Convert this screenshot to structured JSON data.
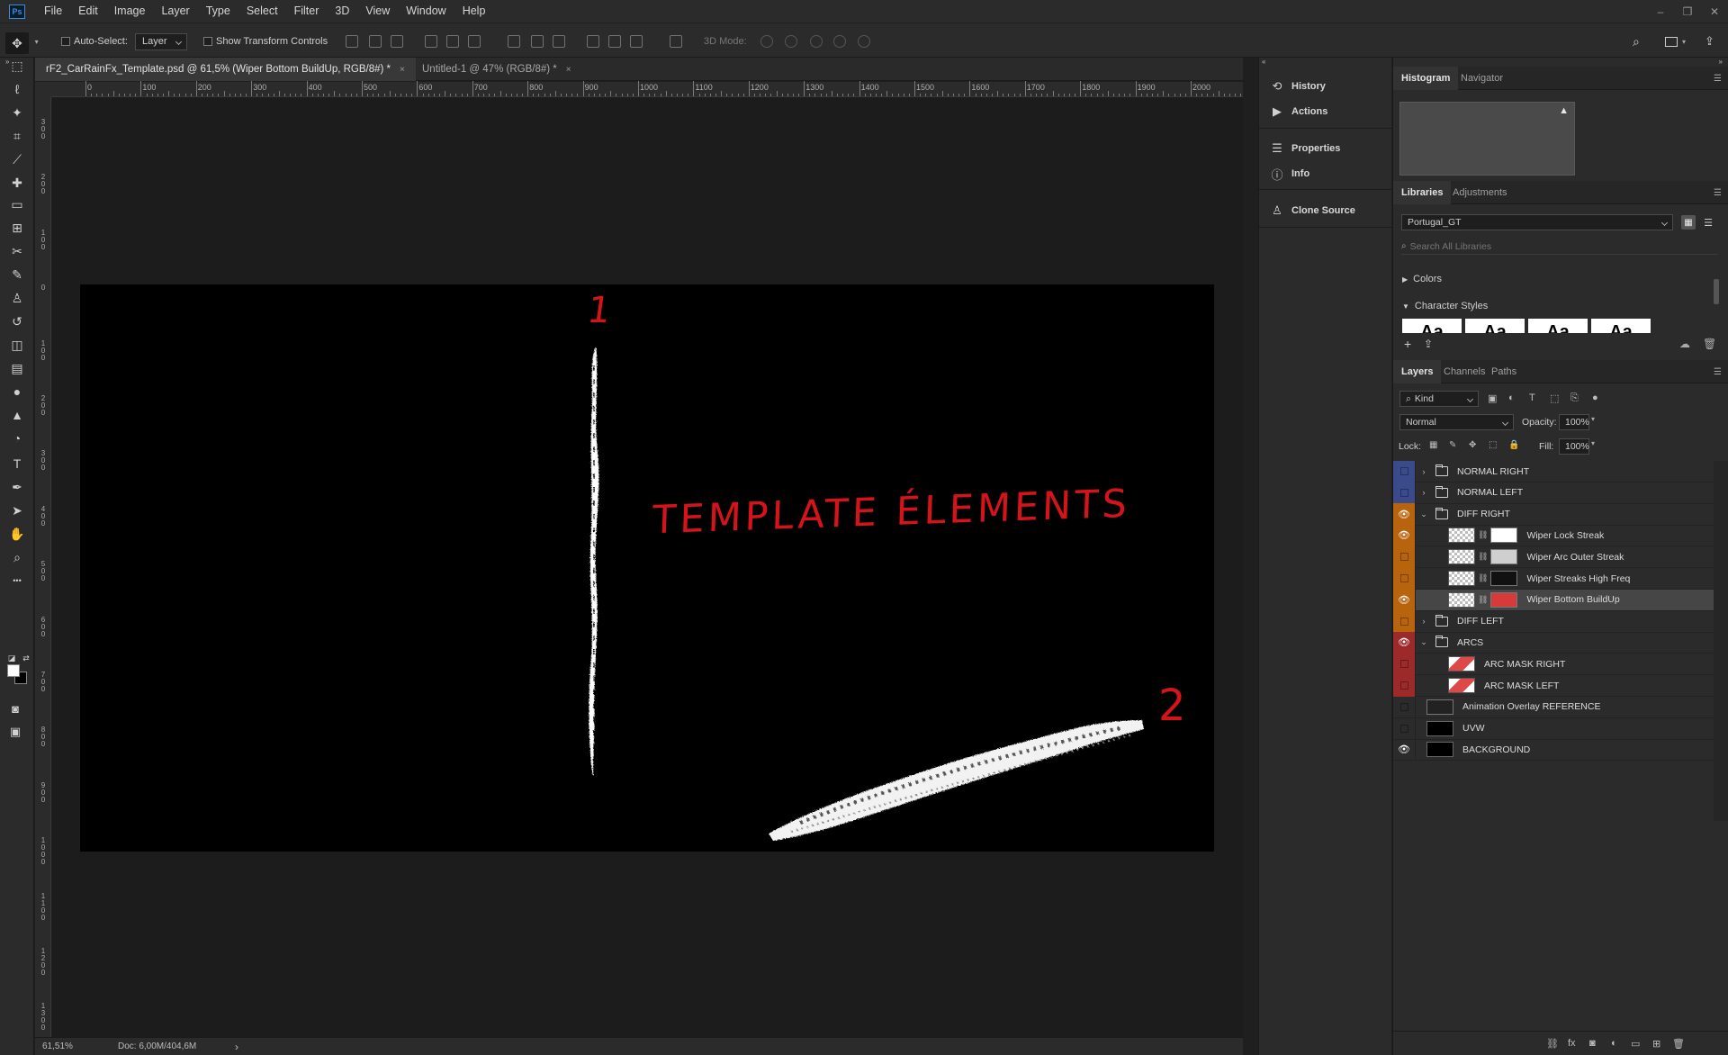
{
  "app": {
    "logo": "Ps"
  },
  "menu": [
    "File",
    "Edit",
    "Image",
    "Layer",
    "Type",
    "Select",
    "Filter",
    "3D",
    "View",
    "Window",
    "Help"
  ],
  "window_controls": [
    "–",
    "❐",
    "✕"
  ],
  "options": {
    "auto_select_label": "Auto-Select:",
    "auto_select_value": "Layer",
    "show_transform_label": "Show Transform Controls",
    "mode_3d_label": "3D Mode:"
  },
  "tabs": [
    {
      "label": "rF2_CarRainFx_Template.psd @ 61,5% (Wiper Bottom BuildUp, RGB/8#) *",
      "close": "×"
    },
    {
      "label": "Untitled-1 @ 47% (RGB/8#) *",
      "close": "×"
    }
  ],
  "ruler_h": [
    "0",
    "100",
    "200",
    "300",
    "400",
    "500",
    "600",
    "700",
    "800",
    "900",
    "1000",
    "1100",
    "1200",
    "1300",
    "1400",
    "1500",
    "1600",
    "1700",
    "1800",
    "1900",
    "2000"
  ],
  "ruler_v": [
    "3\n0\n0",
    "2\n0\n0",
    "1\n0\n0",
    "0",
    "1\n0\n0",
    "2\n0\n0",
    "3\n0\n0",
    "4\n0\n0",
    "5\n0\n0",
    "6\n0\n0",
    "7\n0\n0",
    "8\n0\n0",
    "9\n0\n0",
    "1\n0\n0\n0",
    "1\n1\n0\n0",
    "1\n2\n0\n0",
    "1\n3\n0\n0"
  ],
  "canvas": {
    "annotation_1": "1",
    "annotation_2": "2",
    "title_text": "TEMPLATE ÉLEMENTS",
    "annotation_color": "#d4141a"
  },
  "status": {
    "zoom": "61,51%",
    "doc": "Doc: 6,00M/404,6M",
    "arrow": "›"
  },
  "collapsed_panels": [
    "History",
    "Actions",
    "Properties",
    "Info",
    "Clone Source"
  ],
  "histogram": {
    "tabs": [
      "Histogram",
      "Navigator"
    ],
    "warning": "▲"
  },
  "libraries": {
    "tabs": [
      "Libraries",
      "Adjustments"
    ],
    "selected": "Portugal_GT",
    "search_placeholder": "Search All Libraries",
    "sections": [
      "Colors",
      "Character Styles"
    ],
    "style_preview": "Aa"
  },
  "layers_panel": {
    "tabs": [
      "Layers",
      "Channels",
      "Paths"
    ],
    "filter_label": "Kind",
    "blend_mode": "Normal",
    "opacity_label": "Opacity:",
    "opacity_value": "100%",
    "lock_label": "Lock:",
    "fill_label": "Fill:",
    "fill_value": "100%",
    "layers": [
      {
        "name": "NORMAL RIGHT",
        "type": "group",
        "color": "#3b4a8a",
        "visible": false,
        "expanded": false,
        "indent": 0
      },
      {
        "name": "NORMAL LEFT",
        "type": "group",
        "color": "#3b4a8a",
        "visible": false,
        "expanded": false,
        "indent": 0
      },
      {
        "name": "DIFF RIGHT",
        "type": "group",
        "color": "#b8640f",
        "visible": true,
        "expanded": true,
        "indent": 0
      },
      {
        "name": "Wiper Lock Streak",
        "type": "layer",
        "color": "#b8640f",
        "visible": true,
        "indent": 1,
        "mask": "#ffffff"
      },
      {
        "name": "Wiper Arc Outer Streak",
        "type": "layer",
        "color": "#b8640f",
        "visible": false,
        "indent": 1,
        "mask": "#cfcfcf"
      },
      {
        "name": "Wiper Streaks High Freq",
        "type": "layer",
        "color": "#b8640f",
        "visible": false,
        "indent": 1,
        "mask": "#111111"
      },
      {
        "name": "Wiper Bottom BuildUp",
        "type": "layer",
        "color": "#b8640f",
        "visible": true,
        "indent": 1,
        "mask": "#d73a3a",
        "selected": true
      },
      {
        "name": "DIFF LEFT",
        "type": "group",
        "color": "#b8640f",
        "visible": false,
        "expanded": false,
        "indent": 0
      },
      {
        "name": "ARCS",
        "type": "group",
        "color": "#9c2a2a",
        "visible": true,
        "expanded": true,
        "indent": 0
      },
      {
        "name": "ARC MASK RIGHT",
        "type": "layer",
        "color": "#9c2a2a",
        "visible": false,
        "indent": 1,
        "thumb": "red"
      },
      {
        "name": "ARC MASK LEFT",
        "type": "layer",
        "color": "#9c2a2a",
        "visible": false,
        "indent": 1,
        "thumb": "red"
      },
      {
        "name": "Animation Overlay REFERENCE",
        "type": "layer",
        "color": "",
        "visible": false,
        "indent": 0,
        "thumb": "dark"
      },
      {
        "name": "UVW",
        "type": "layer",
        "color": "",
        "visible": false,
        "indent": 0,
        "thumb": "black"
      },
      {
        "name": "BACKGROUND",
        "type": "layer",
        "color": "",
        "visible": true,
        "indent": 0,
        "thumb": "black"
      }
    ]
  }
}
